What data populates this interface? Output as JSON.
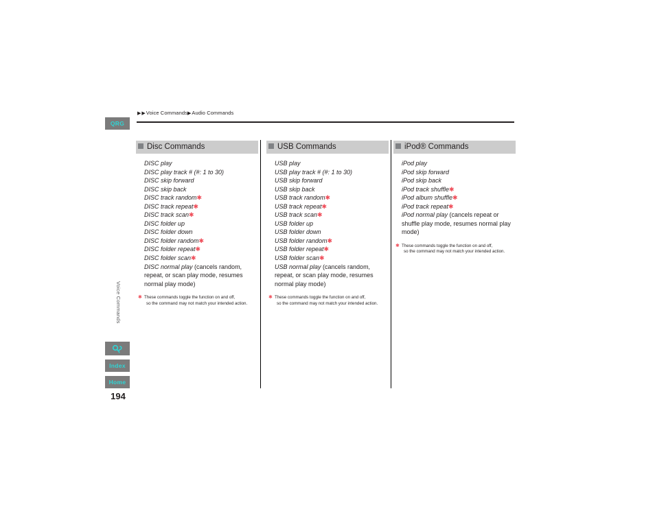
{
  "rail": {
    "qrg_label": "QRG",
    "search_icon": "search-icon",
    "index_label": "Index",
    "home_label": "Home",
    "chapter_tab": "Voice Commands",
    "page_number": "194"
  },
  "breadcrumb": {
    "arrow": "▶",
    "item1": "Voice Commands",
    "item2": "Audio Commands"
  },
  "footnote": {
    "marker": "✱",
    "line1": "These commands toggle the function on and off,",
    "line2": "so the command may not match your intended action."
  },
  "colors": {
    "header_bar": "#cccccc",
    "header_square": "#808285",
    "rail_button": "#7b7b7b",
    "rail_text": "#2fd5d5",
    "asterisk": "#ef4e5a",
    "rule": "#231f20"
  },
  "columns": [
    {
      "id": "disc",
      "title": "Disc Commands",
      "items": [
        {
          "text": "DISC play",
          "star": false
        },
        {
          "text": "DISC play track # (#: 1 to 30)",
          "star": false
        },
        {
          "text": "DISC skip forward",
          "star": false
        },
        {
          "text": "DISC skip back",
          "star": false
        },
        {
          "text": "DISC track random",
          "star": true
        },
        {
          "text": "DISC track repeat",
          "star": true
        },
        {
          "text": "DISC track scan",
          "star": true
        },
        {
          "text": "DISC folder up",
          "star": false
        },
        {
          "text": "DISC folder down",
          "star": false
        },
        {
          "text": "DISC folder random",
          "star": true
        },
        {
          "text": "DISC folder repeat",
          "star": true
        },
        {
          "text": "DISC folder scan",
          "star": true
        },
        {
          "text": "DISC normal play",
          "suffix": " (cancels random, repeat, or scan play mode, resumes normal play mode)",
          "star": false
        }
      ]
    },
    {
      "id": "usb",
      "title": "USB Commands",
      "items": [
        {
          "text": "USB play",
          "star": false
        },
        {
          "text": "USB play track # (#: 1 to 30)",
          "star": false
        },
        {
          "text": "USB skip forward",
          "star": false
        },
        {
          "text": "USB skip back",
          "star": false
        },
        {
          "text": "USB track random",
          "star": true
        },
        {
          "text": "USB track repeat",
          "star": true
        },
        {
          "text": "USB track scan",
          "star": true
        },
        {
          "text": "USB folder up",
          "star": false
        },
        {
          "text": "USB folder down",
          "star": false
        },
        {
          "text": "USB folder random",
          "star": true
        },
        {
          "text": "USB folder repeat",
          "star": true
        },
        {
          "text": "USB folder scan",
          "star": true
        },
        {
          "text": "USB normal play",
          "suffix": " (cancels random, repeat, or scan play mode, resumes normal play mode)",
          "star": false
        }
      ]
    },
    {
      "id": "ipod",
      "title": "iPod® Commands",
      "items": [
        {
          "text": "iPod play",
          "star": false
        },
        {
          "text": "iPod skip forward",
          "star": false
        },
        {
          "text": "iPod skip back",
          "star": false
        },
        {
          "text": "iPod track shuffle",
          "star": true
        },
        {
          "text": "iPod album shuffle",
          "star": true
        },
        {
          "text": "iPod track repeat",
          "star": true
        },
        {
          "text": "iPod normal play",
          "suffix": " (cancels repeat or shuffle play mode, resumes normal play mode)",
          "star": false
        }
      ]
    }
  ]
}
